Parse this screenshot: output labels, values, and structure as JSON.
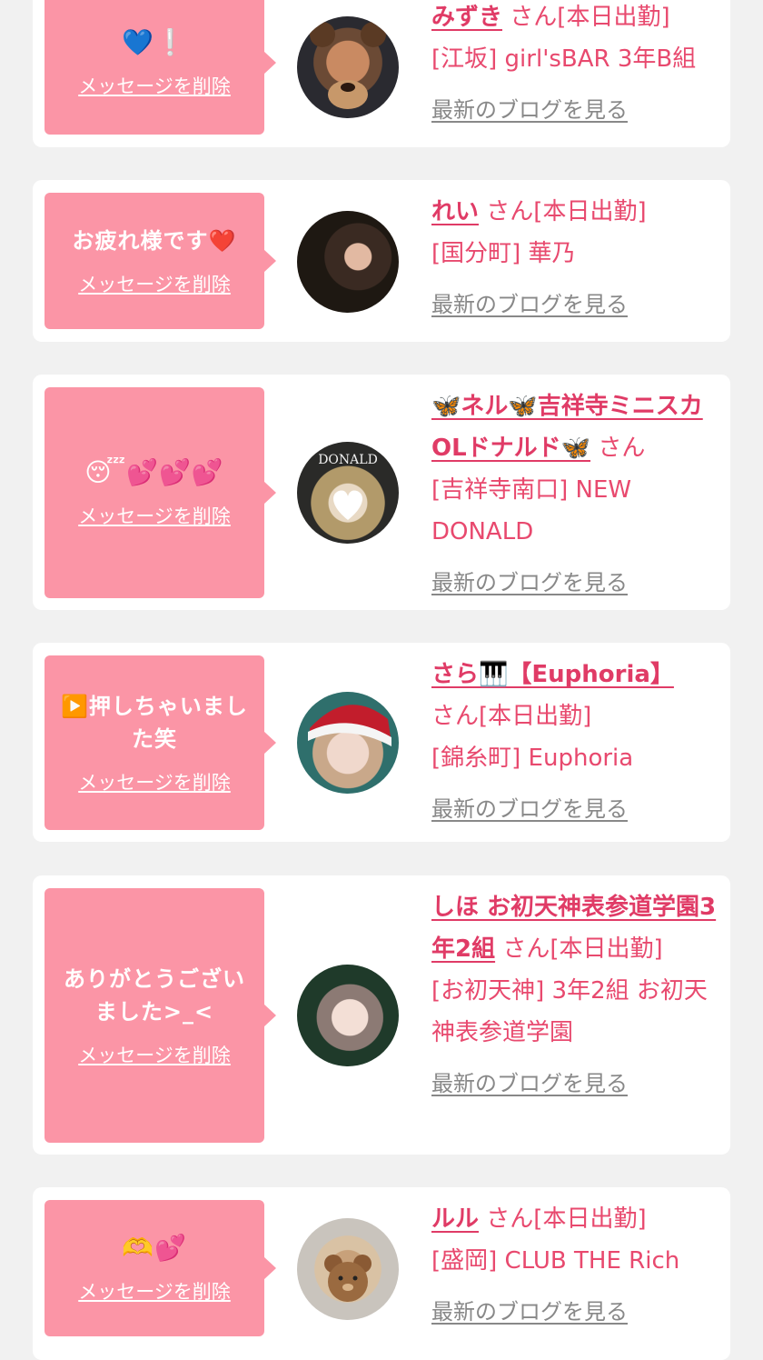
{
  "common": {
    "delete_label": "メッセージを削除",
    "blog_label": "最新のブログを見る",
    "san": "さん"
  },
  "cards": [
    {
      "message": "💙❕",
      "name": "みずき",
      "status": "[本日出勤]",
      "shop": "[江坂] girl'sBAR 3年B組"
    },
    {
      "message": "お疲れ様です❤️",
      "name": "れい",
      "status": "[本日出勤]",
      "shop": "[国分町] 華乃"
    },
    {
      "message": "😴💕💕💕",
      "name": "🦋ネル🦋吉祥寺ミニスカOLドナルド🦋",
      "status": "",
      "shop": "[吉祥寺南口] NEW DONALD"
    },
    {
      "message": "▶️押しちゃいました笑",
      "name": "さら🎹【Euphoria】",
      "status": "[本日出勤]",
      "shop": "[錦糸町] Euphoria"
    },
    {
      "message": "ありがとうございました>_<",
      "name": "しほ お初天神表参道学園3年2組",
      "status": "[本日出勤]",
      "shop": "[お初天神] 3年2組 お初天神表参道学園"
    },
    {
      "message": "🫶💕",
      "name": "ルル",
      "status": "[本日出勤]",
      "shop": "[盛岡] CLUB THE Rich"
    }
  ]
}
